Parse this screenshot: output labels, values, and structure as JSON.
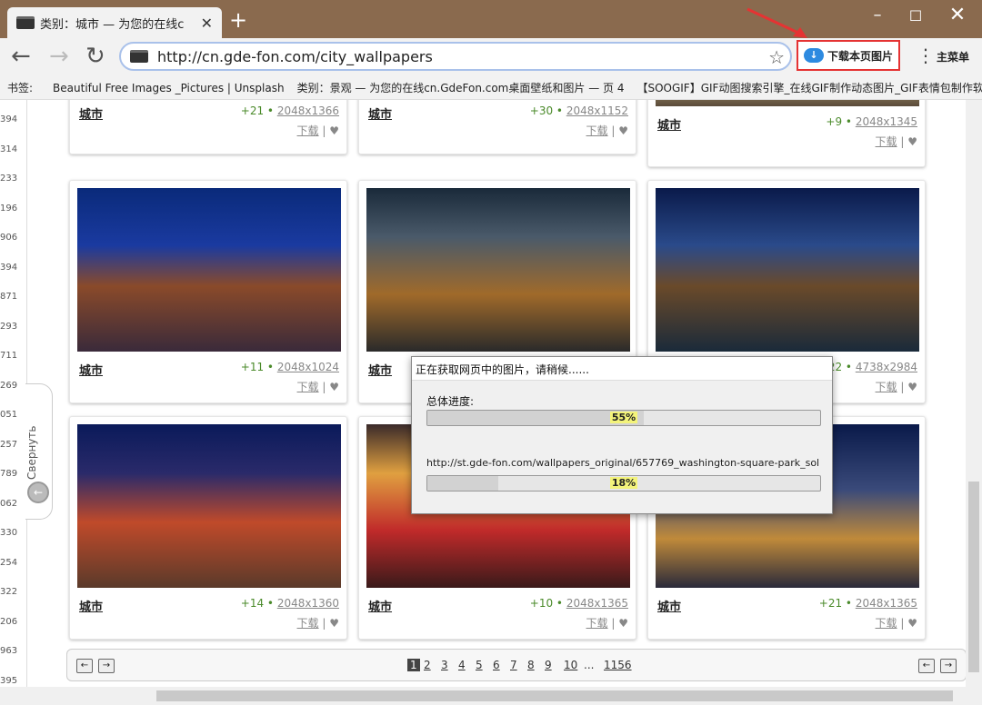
{
  "browser": {
    "tab_title": "类别：城市 — 为您的在线c",
    "tab_close": "✕",
    "new_tab": "+",
    "url": "http://cn.gde-fon.com/city_wallpapers",
    "download_button_label": "下载本页图片",
    "menu_label": "主菜单",
    "bookmarks_label": "书签:",
    "bookmarks": [
      "Beautiful Free Images _Pictures | Unsplash",
      "类别：景观 — 为您的在线cn.GdeFon.com桌面壁纸和图片 — 页 4",
      "【SOOGIF】GIF动图搜索引擎_在线GIF制作动态图片_GIF表情包制作软件"
    ]
  },
  "sidebar": {
    "collapse_label": "Свернуть",
    "numbers": [
      "394",
      "314",
      "233",
      "196",
      "906",
      "394",
      "871",
      "293",
      "711",
      "269",
      "051",
      "257",
      "789",
      "062",
      "330",
      "254",
      "322",
      "206",
      "963",
      "395"
    ]
  },
  "cards": [
    {
      "category": "城市",
      "votes": "+21",
      "size": "2048x1366",
      "download": "下载",
      "heart": "♥",
      "image": "city-night-photo"
    },
    {
      "category": "城市",
      "votes": "+30",
      "size": "2048x1152",
      "download": "下载",
      "heart": "♥",
      "image": "city-night-photo"
    },
    {
      "category": "城市",
      "votes": "+9",
      "size": "2048x1345",
      "download": "下载",
      "heart": "♥",
      "image": "city-night-photo"
    },
    {
      "category": "城市",
      "votes": "+11",
      "size": "2048x1024",
      "download": "下载",
      "heart": "♥",
      "image": "groningen-night"
    },
    {
      "category": "城市",
      "votes": "",
      "size": "",
      "download": "",
      "heart": "",
      "image": "canal-tower-night"
    },
    {
      "category": "",
      "votes": "+22",
      "size": "4738x2984",
      "download": "下载",
      "heart": "♥",
      "image": "canal-reflection-night"
    },
    {
      "category": "城市",
      "votes": "+14",
      "size": "2048x1360",
      "download": "下载",
      "heart": "♥",
      "image": "colorful-houses-night"
    },
    {
      "category": "城市",
      "votes": "+10",
      "size": "2048x1365",
      "download": "下载",
      "heart": "♥",
      "image": "market-umbrellas-night"
    },
    {
      "category": "城市",
      "votes": "+21",
      "size": "2048x1365",
      "download": "下载",
      "heart": "♥",
      "image": "harbor-boats-night"
    }
  ],
  "pagination": {
    "pages": [
      "1",
      "2",
      "3",
      "4",
      "5",
      "6",
      "7",
      "8",
      "9",
      "10",
      "...",
      "1156"
    ],
    "current": "1",
    "prev": "←",
    "next": "→"
  },
  "dialog": {
    "title": "正在获取网页中的图片，请稍候......",
    "total_label": "总体进度:",
    "total_percent": "55%",
    "total_progress": 0.55,
    "file_url": "http://st.gde-fon.com/wallpapers_original/657769_washington-square-park_sol",
    "file_percent": "18%",
    "file_progress": 0.18
  },
  "colors": {
    "frame": "#8a6a4e",
    "highlight_red": "#e53333",
    "vote_green": "#4a8a2a"
  }
}
